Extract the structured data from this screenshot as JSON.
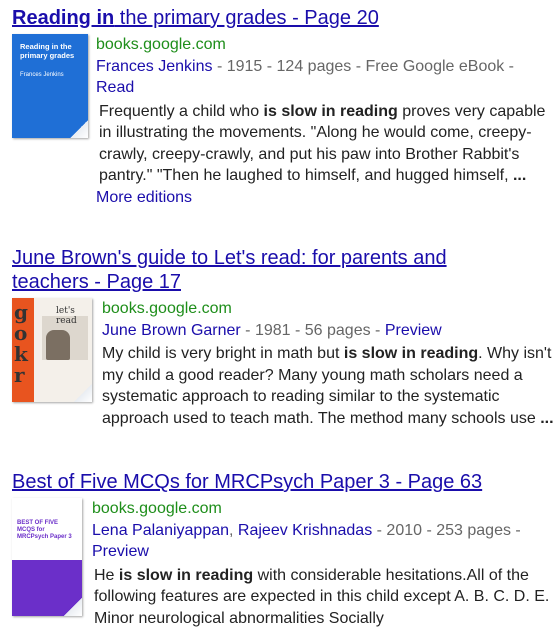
{
  "results": [
    {
      "title_prefix": "Reading in",
      "title_rest": " the primary grades - Page 20",
      "url": "books.google.com",
      "author": "Frances Jenkins",
      "meta": " - 1915 - 124 pages - Free Google eBook -",
      "meta_link": "Read",
      "snippet_a": "Frequently a child who ",
      "snippet_bold": "is slow in reading",
      "snippet_b": " proves very capable in illustrating the movements. \"Along he would come, creepy-crawly, creepy-crawly, and put his paw into Brother Rabbit's pantry.\" \"Then he laughed to himself, and hugged himself, ",
      "snippet_ellipsis": "...",
      "extra_link": "More editions",
      "cover_title": "Reading in the primary grades",
      "cover_author": "Frances Jenkins",
      "cover_color": "#1f6fd6"
    },
    {
      "title": "June Brown's guide to Let's read: for parents and teachers - Page 17",
      "url": "books.google.com",
      "author": "June Brown Garner",
      "meta": " - 1981 - 56 pages - ",
      "meta_link": "Preview",
      "snippet_a": "My child is very bright in math but ",
      "snippet_bold": "is slow in reading",
      "snippet_b": ". Why isn't my child a good reader? Many young math scholars need a systematic approach to reading similar to the systematic approach used to teach math. The method many schools use ",
      "snippet_ellipsis": "...",
      "cover_title": "let's read",
      "cover_color": "#e8541f"
    },
    {
      "title": "Best of Five MCQs for MRCPsych Paper 3 - Page 63",
      "url": "books.google.com",
      "author1": "Lena Palaniyappan",
      "author_sep": ", ",
      "author2": "Rajeev Krishnadas",
      "meta": " - 2010 - 253 pages -",
      "meta_link": "Preview",
      "snippet_a": "He ",
      "snippet_bold": "is slow in reading",
      "snippet_b": " with considerable hesitations.All of the following features are expected in this child except A. B. C. D. E. Minor neurological abnormalities Socially",
      "cover_title": "BEST OF FIVE MCQS for MRCPsych Paper 3",
      "cover_color": "#6b2fc9"
    }
  ]
}
